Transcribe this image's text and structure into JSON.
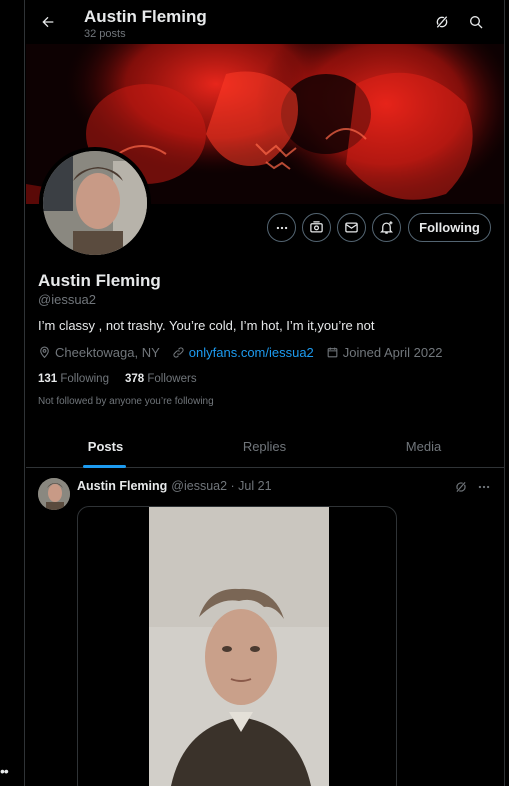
{
  "header": {
    "title": "Austin Fleming",
    "subtitle": "32 posts"
  },
  "profile": {
    "name": "Austin Fleming",
    "handle": "@iessua2",
    "bio": "I’m classy , not trashy. You’re cold, I’m hot, I’m it,you’re not",
    "location": "Cheektowaga, NY",
    "link": "onlyfans.com/iessua2",
    "joined": "Joined April 2022",
    "following_count": "131",
    "following_label": "Following",
    "followers_count": "378",
    "followers_label": "Followers",
    "not_followed_text": "Not followed by anyone you’re following",
    "follow_button": "Following"
  },
  "tabs": [
    {
      "label": "Posts",
      "active": true
    },
    {
      "label": "Replies",
      "active": false
    },
    {
      "label": "Media",
      "active": false
    }
  ],
  "post": {
    "author": "Austin Fleming",
    "meta": "@iessua2 · Jul 21"
  },
  "colors": {
    "accent": "#1d9bf0",
    "banner_red": "#e0201d",
    "muted": "#71767b"
  },
  "icons": [
    "back-arrow-icon",
    "grok-icon",
    "search-icon",
    "more-icon",
    "subscribe-icon",
    "message-icon",
    "notify-bell-icon",
    "location-icon",
    "link-icon",
    "calendar-icon"
  ]
}
